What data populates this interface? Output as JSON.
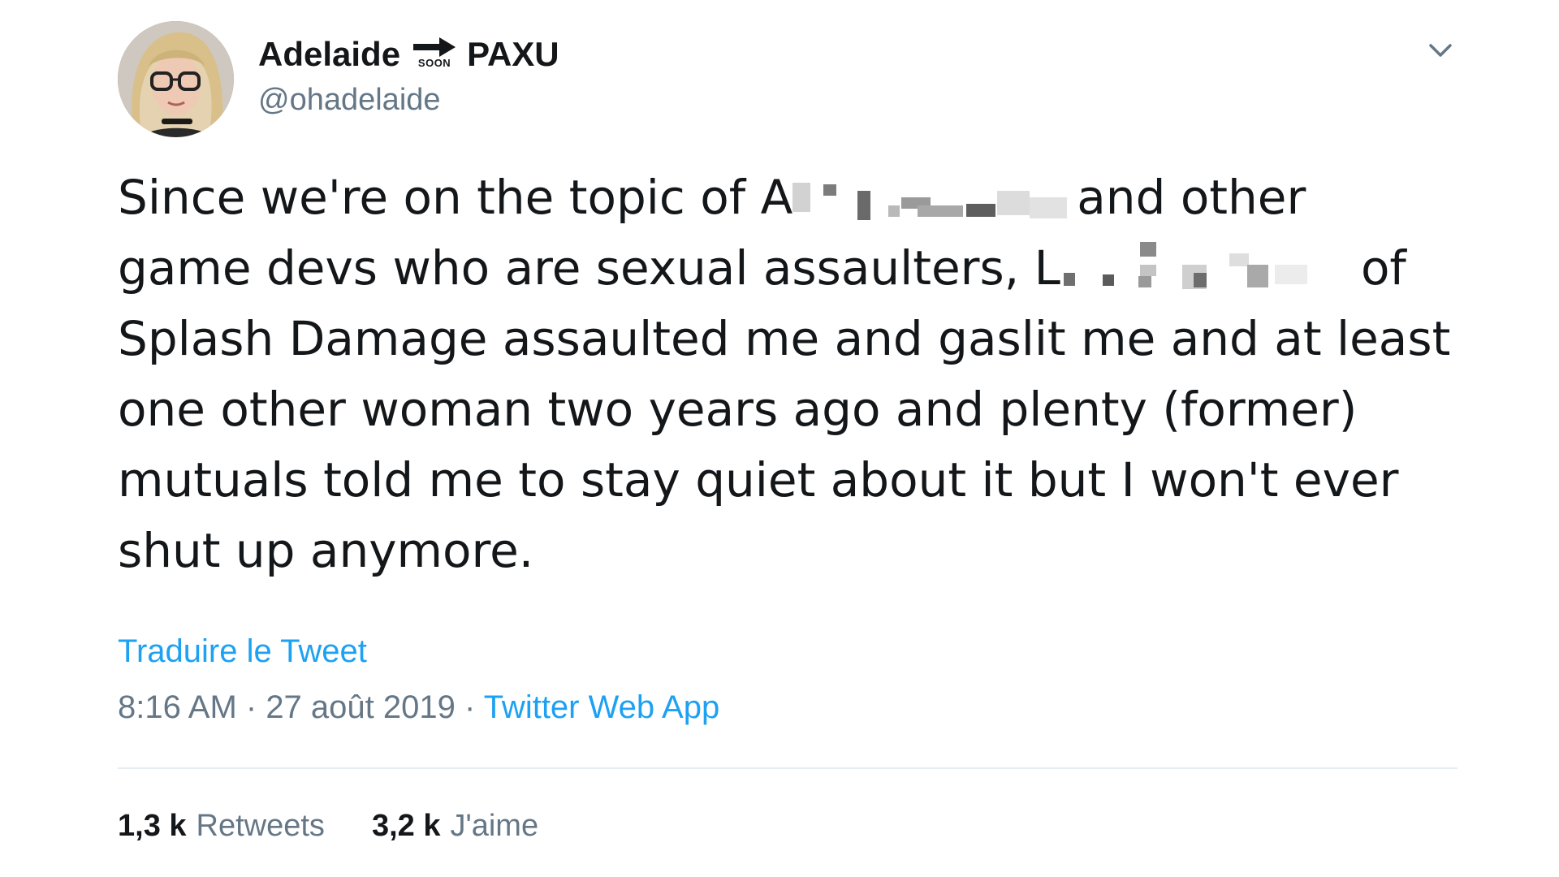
{
  "author": {
    "name_first": "Adelaide",
    "badge_text": "SOON",
    "name_second": "PAXU",
    "handle": "@ohadelaide"
  },
  "tweet": {
    "line1_start": "Since we're on the topic of A",
    "line1_end": "and other",
    "line2_start": "game devs who are sexual assaulters, L",
    "line2_end": "of",
    "line3": "Splash Damage assaulted me and gaslit me and at least",
    "line4": "one other woman two years ago and plenty (former)",
    "line5": "mutuals told me to stay quiet about it but I won't ever",
    "line6": "shut up anymore."
  },
  "translate_label": "Traduire le Tweet",
  "meta": {
    "time": "8:16 AM",
    "separator1": " · ",
    "date": "27 août 2019",
    "separator2": " · ",
    "source": "Twitter Web App"
  },
  "stats": {
    "retweets_count": "1,3 k",
    "retweets_label": "Retweets",
    "likes_count": "3,2 k",
    "likes_label": "J'aime"
  },
  "icons": {
    "caret": "chevron-down-icon",
    "badge_arrow": "arrow-right-icon"
  },
  "colors": {
    "text": "#14171a",
    "secondary": "#657786",
    "link": "#1da1f2",
    "divider": "#e6ecf0"
  }
}
